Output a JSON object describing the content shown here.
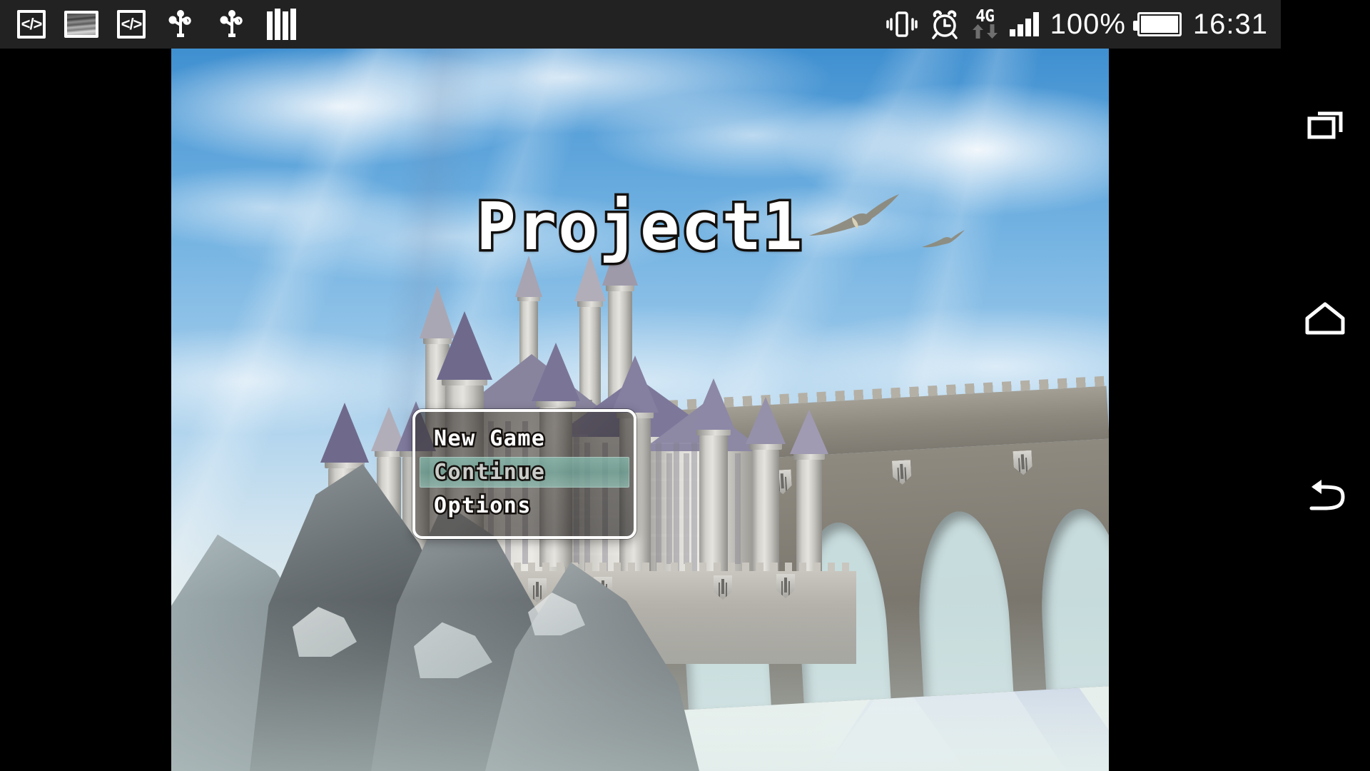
{
  "statusbar": {
    "background": "#222222",
    "left_icons": [
      {
        "name": "code-icon-1",
        "glyph": "</>"
      },
      {
        "name": "image-icon",
        "glyph": "image"
      },
      {
        "name": "code-icon-2",
        "glyph": "</>"
      },
      {
        "name": "usb-icon-1",
        "glyph": "usb"
      },
      {
        "name": "usb-icon-2",
        "glyph": "usb"
      },
      {
        "name": "books-icon",
        "glyph": "books"
      }
    ],
    "right_icons": [
      {
        "name": "vibrate-icon",
        "glyph": "vibrate"
      },
      {
        "name": "alarm-icon",
        "glyph": "alarm"
      },
      {
        "name": "network-type-icon",
        "glyph": "4G"
      },
      {
        "name": "signal-bars-icon",
        "glyph": "signal"
      }
    ],
    "battery_percent": "100%",
    "clock": "16:31"
  },
  "game": {
    "title": "Project1",
    "menu": {
      "items": [
        {
          "label": "New Game",
          "selected": false,
          "disabled": false
        },
        {
          "label": "Continue",
          "selected": true,
          "disabled": true
        },
        {
          "label": "Options",
          "selected": false,
          "disabled": false
        }
      ],
      "highlight_color": "#8cc4b6",
      "border_color": "#ffffff"
    },
    "scene": {
      "description": "Castle on rocky mount with stone viaduct under blue sky",
      "sky_top_color": "#3f8fd0",
      "sky_bottom_color": "#eef2ee",
      "castle_roof_color": "#8f89a8",
      "castle_stone_color": "#e0ded8",
      "viaduct_stone_color": "#8e8a80",
      "rock_color": "#6b6b68",
      "birds": 2
    }
  },
  "navbar": {
    "buttons": [
      {
        "name": "recent-apps",
        "label": "Recent apps"
      },
      {
        "name": "home",
        "label": "Home"
      },
      {
        "name": "back",
        "label": "Back"
      }
    ]
  }
}
